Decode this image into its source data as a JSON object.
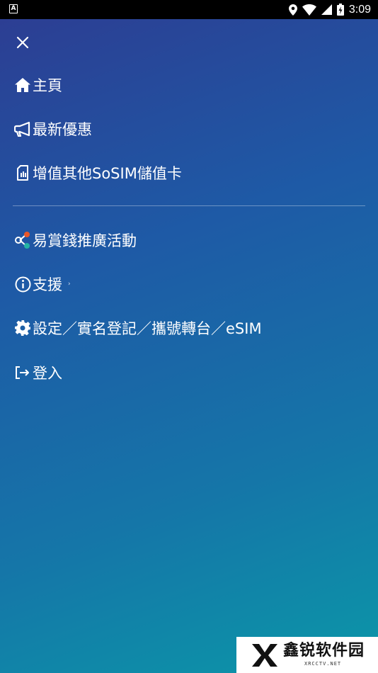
{
  "status_bar": {
    "app_indicator": "A",
    "time": "3:09",
    "icons": [
      "location-icon",
      "wifi-icon",
      "signal-icon",
      "battery-icon"
    ]
  },
  "menu": {
    "close_icon": "close-icon",
    "items": [
      {
        "label": "主頁",
        "icon": "home-icon"
      },
      {
        "label": "最新優惠",
        "icon": "megaphone-icon"
      },
      {
        "label": "增值其他SoSIM儲值卡",
        "icon": "sim-card-icon"
      },
      {
        "label": "易賞錢推廣活動",
        "icon": "share-icon"
      },
      {
        "label": "支援",
        "icon": "info-icon",
        "suffix": "›"
      },
      {
        "label": "設定／實名登記／攜號轉台／eSIM",
        "icon": "gear-icon"
      },
      {
        "label": "登入",
        "icon": "login-icon"
      }
    ]
  },
  "watermark": {
    "title": "鑫锐软件园",
    "subtitle": "XRCCTV.NET"
  },
  "colors": {
    "gradient_start": "#2c3e93",
    "gradient_end": "#0b97a8",
    "text": "#ffffff"
  }
}
